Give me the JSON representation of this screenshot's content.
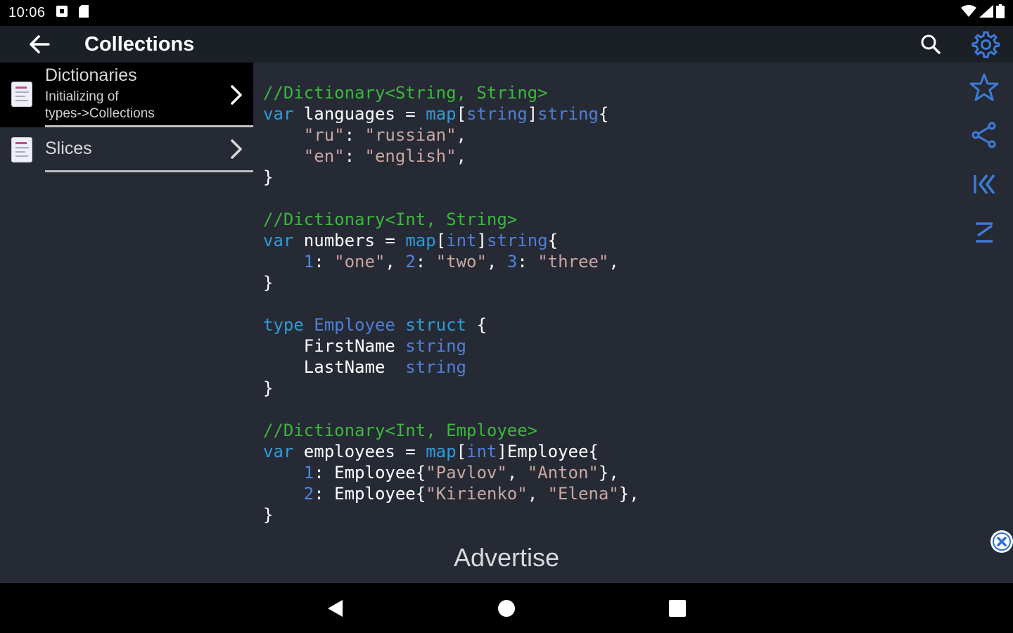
{
  "status_bar": {
    "time": "10:06"
  },
  "app_bar": {
    "title": "Collections"
  },
  "sidebar": {
    "items": [
      {
        "title": "Dictionaries",
        "subtitle_line1": "Initializing of",
        "subtitle_line2": "types->Collections",
        "active": true
      },
      {
        "title": "Slices",
        "active": false
      }
    ]
  },
  "code": {
    "lines": [
      {
        "parts": [
          {
            "c": "com",
            "t": "//Dictionary<String, String>"
          }
        ]
      },
      {
        "parts": [
          {
            "c": "kw",
            "t": "var"
          },
          {
            "c": "id",
            "t": " languages = "
          },
          {
            "c": "kw",
            "t": "map"
          },
          {
            "c": "id",
            "t": "["
          },
          {
            "c": "ty",
            "t": "string"
          },
          {
            "c": "id",
            "t": "]"
          },
          {
            "c": "ty",
            "t": "string"
          },
          {
            "c": "id",
            "t": "{"
          }
        ]
      },
      {
        "parts": [
          {
            "c": "id",
            "t": "    "
          },
          {
            "c": "str",
            "t": "\"ru\""
          },
          {
            "c": "id",
            "t": ": "
          },
          {
            "c": "str",
            "t": "\"russian\""
          },
          {
            "c": "id",
            "t": ","
          }
        ]
      },
      {
        "parts": [
          {
            "c": "id",
            "t": "    "
          },
          {
            "c": "str",
            "t": "\"en\""
          },
          {
            "c": "id",
            "t": ": "
          },
          {
            "c": "str",
            "t": "\"english\""
          },
          {
            "c": "id",
            "t": ","
          }
        ]
      },
      {
        "parts": [
          {
            "c": "id",
            "t": "}"
          }
        ]
      },
      {
        "parts": [
          {
            "c": "id",
            "t": ""
          }
        ]
      },
      {
        "parts": [
          {
            "c": "com",
            "t": "//Dictionary<Int, String>"
          }
        ]
      },
      {
        "parts": [
          {
            "c": "kw",
            "t": "var"
          },
          {
            "c": "id",
            "t": " numbers = "
          },
          {
            "c": "kw",
            "t": "map"
          },
          {
            "c": "id",
            "t": "["
          },
          {
            "c": "ty",
            "t": "int"
          },
          {
            "c": "id",
            "t": "]"
          },
          {
            "c": "ty",
            "t": "string"
          },
          {
            "c": "id",
            "t": "{"
          }
        ]
      },
      {
        "parts": [
          {
            "c": "id",
            "t": "    "
          },
          {
            "c": "num",
            "t": "1"
          },
          {
            "c": "id",
            "t": ": "
          },
          {
            "c": "str",
            "t": "\"one\""
          },
          {
            "c": "id",
            "t": ", "
          },
          {
            "c": "num",
            "t": "2"
          },
          {
            "c": "id",
            "t": ": "
          },
          {
            "c": "str",
            "t": "\"two\""
          },
          {
            "c": "id",
            "t": ", "
          },
          {
            "c": "num",
            "t": "3"
          },
          {
            "c": "id",
            "t": ": "
          },
          {
            "c": "str",
            "t": "\"three\""
          },
          {
            "c": "id",
            "t": ","
          }
        ]
      },
      {
        "parts": [
          {
            "c": "id",
            "t": "}"
          }
        ]
      },
      {
        "parts": [
          {
            "c": "id",
            "t": ""
          }
        ]
      },
      {
        "parts": [
          {
            "c": "kw",
            "t": "type"
          },
          {
            "c": "id",
            "t": " "
          },
          {
            "c": "ty",
            "t": "Employee"
          },
          {
            "c": "id",
            "t": " "
          },
          {
            "c": "kw",
            "t": "struct"
          },
          {
            "c": "id",
            "t": " {"
          }
        ]
      },
      {
        "parts": [
          {
            "c": "id",
            "t": "    FirstName "
          },
          {
            "c": "ty",
            "t": "string"
          }
        ]
      },
      {
        "parts": [
          {
            "c": "id",
            "t": "    LastName  "
          },
          {
            "c": "ty",
            "t": "string"
          }
        ]
      },
      {
        "parts": [
          {
            "c": "id",
            "t": "}"
          }
        ]
      },
      {
        "parts": [
          {
            "c": "id",
            "t": ""
          }
        ]
      },
      {
        "parts": [
          {
            "c": "com",
            "t": "//Dictionary<Int, Employee>"
          }
        ]
      },
      {
        "parts": [
          {
            "c": "kw",
            "t": "var"
          },
          {
            "c": "id",
            "t": " employees = "
          },
          {
            "c": "kw",
            "t": "map"
          },
          {
            "c": "id",
            "t": "["
          },
          {
            "c": "ty",
            "t": "int"
          },
          {
            "c": "id",
            "t": "]Employee{"
          }
        ]
      },
      {
        "parts": [
          {
            "c": "id",
            "t": "    "
          },
          {
            "c": "num",
            "t": "1"
          },
          {
            "c": "id",
            "t": ": Employee{"
          },
          {
            "c": "str",
            "t": "\"Pavlov\""
          },
          {
            "c": "id",
            "t": ", "
          },
          {
            "c": "str",
            "t": "\"Anton\""
          },
          {
            "c": "id",
            "t": "},"
          }
        ]
      },
      {
        "parts": [
          {
            "c": "id",
            "t": "    "
          },
          {
            "c": "num",
            "t": "2"
          },
          {
            "c": "id",
            "t": ": Employee{"
          },
          {
            "c": "str",
            "t": "\"Kirienko\""
          },
          {
            "c": "id",
            "t": ", "
          },
          {
            "c": "str",
            "t": "\"Elena\""
          },
          {
            "c": "id",
            "t": "},"
          }
        ]
      },
      {
        "parts": [
          {
            "c": "id",
            "t": "}"
          }
        ]
      }
    ]
  },
  "ad": {
    "label": "Advertise"
  },
  "icons": {
    "back": "arrow-left-icon",
    "search": "search-icon",
    "settings": "gear-icon",
    "favorite": "star-icon",
    "share": "share-icon",
    "first": "skip-first-icon",
    "last": "skip-last-icon"
  },
  "colors": {
    "background": "#262a35",
    "app_bar": "#1b1f26",
    "accent": "#3d7bd8",
    "comment": "#3ab83a",
    "keyword": "#2f9bd8",
    "string": "#c9a7a0"
  }
}
